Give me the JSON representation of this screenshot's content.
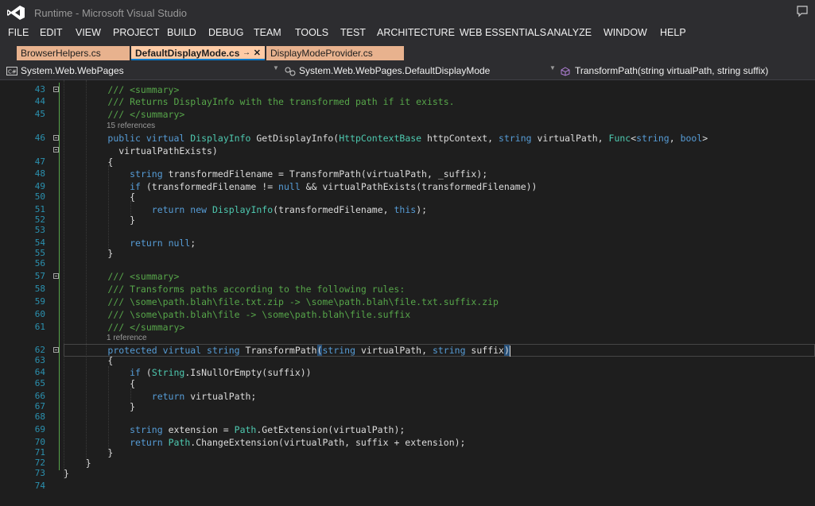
{
  "window": {
    "title": "Runtime - Microsoft Visual Studio"
  },
  "menu": [
    "FILE",
    "EDIT",
    "VIEW",
    "PROJECT",
    "BUILD",
    "DEBUG",
    "TEAM",
    "TOOLS",
    "TEST",
    "ARCHITECTURE",
    "WEB ESSENTIALS",
    "ANALYZE",
    "WINDOW",
    "HELP"
  ],
  "tabs": [
    {
      "label": "BrowserHelpers.cs",
      "active": false
    },
    {
      "label": "DefaultDisplayMode.cs",
      "active": true
    },
    {
      "label": "DisplayModeProvider.cs",
      "active": false
    }
  ],
  "navbar": {
    "project": "System.Web.WebPages",
    "type": "System.Web.WebPages.DefaultDisplayMode",
    "member": "TransformPath(string virtualPath, string suffix)"
  },
  "colors": {
    "background": "#1e1e1e",
    "keyword": "#569cd6",
    "type": "#4ec9b0",
    "comment": "#57a64a",
    "line_number": "#2b91af",
    "tab_active": "#ffcba5",
    "tab_inactive": "#e8b28e"
  },
  "editor": {
    "codelens": [
      {
        "after_line": 45,
        "text": "15 references"
      },
      {
        "after_line": 61,
        "text": "1 reference"
      }
    ],
    "lines": [
      {
        "num": "43",
        "text": "        /// <summary>"
      },
      {
        "num": "44",
        "text": "        /// Returns DisplayInfo with the transformed path if it exists."
      },
      {
        "num": "45",
        "text": "        /// </summary>"
      },
      {
        "num": "46",
        "text": "        public virtual DisplayInfo GetDisplayInfo(HttpContextBase httpContext, string virtualPath, Func<string, bool>"
      },
      {
        "num": "",
        "text": "          virtualPathExists)"
      },
      {
        "num": "47",
        "text": "        {"
      },
      {
        "num": "48",
        "text": "            string transformedFilename = TransformPath(virtualPath, _suffix);"
      },
      {
        "num": "49",
        "text": "            if (transformedFilename != null && virtualPathExists(transformedFilename))"
      },
      {
        "num": "50",
        "text": "            {"
      },
      {
        "num": "51",
        "text": "                return new DisplayInfo(transformedFilename, this);"
      },
      {
        "num": "52",
        "text": "            }"
      },
      {
        "num": "53",
        "text": ""
      },
      {
        "num": "54",
        "text": "            return null;"
      },
      {
        "num": "55",
        "text": "        }"
      },
      {
        "num": "56",
        "text": ""
      },
      {
        "num": "57",
        "text": "        /// <summary>"
      },
      {
        "num": "58",
        "text": "        /// Transforms paths according to the following rules:"
      },
      {
        "num": "59",
        "text": "        /// \\some\\path.blah\\file.txt.zip -> \\some\\path.blah\\file.txt.suffix.zip"
      },
      {
        "num": "60",
        "text": "        /// \\some\\path.blah\\file -> \\some\\path.blah\\file.suffix"
      },
      {
        "num": "61",
        "text": "        /// </summary>"
      },
      {
        "num": "62",
        "text": "        protected virtual string TransformPath(string virtualPath, string suffix)"
      },
      {
        "num": "63",
        "text": "        {"
      },
      {
        "num": "64",
        "text": "            if (String.IsNullOrEmpty(suffix))"
      },
      {
        "num": "65",
        "text": "            {"
      },
      {
        "num": "66",
        "text": "                return virtualPath;"
      },
      {
        "num": "67",
        "text": "            }"
      },
      {
        "num": "68",
        "text": ""
      },
      {
        "num": "69",
        "text": "            string extension = Path.GetExtension(virtualPath);"
      },
      {
        "num": "70",
        "text": "            return Path.ChangeExtension(virtualPath, suffix + extension);"
      },
      {
        "num": "71",
        "text": "        }"
      },
      {
        "num": "72",
        "text": "    }"
      },
      {
        "num": "73",
        "text": "}"
      },
      {
        "num": "74",
        "text": ""
      }
    ]
  }
}
